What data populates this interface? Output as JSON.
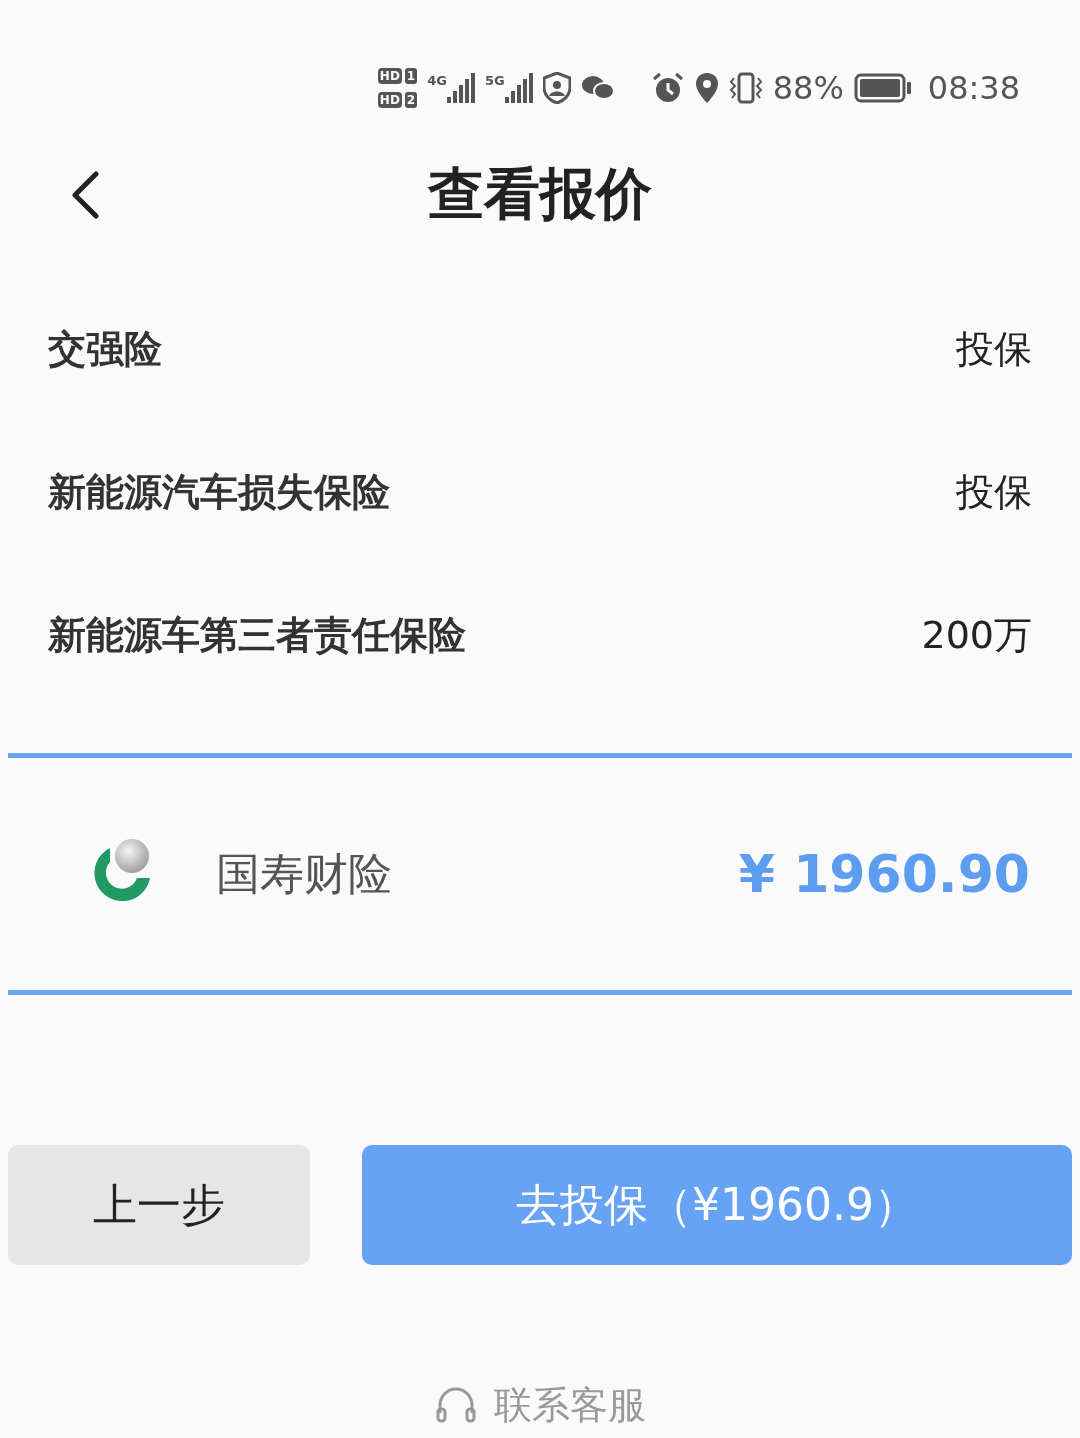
{
  "status_bar": {
    "sims": [
      {
        "label": "HD",
        "slot": "1"
      },
      {
        "label": "HD",
        "slot": "2"
      }
    ],
    "networks": [
      "4G",
      "5G"
    ],
    "battery_text": "88%",
    "time": "08:38"
  },
  "header": {
    "title": "查看报价"
  },
  "coverages": [
    {
      "name": "交强险",
      "value": "投保"
    },
    {
      "name": "新能源汽车损失保险",
      "value": "投保"
    },
    {
      "name": "新能源车第三者责任保险",
      "value": "200万"
    }
  ],
  "quote": {
    "company": "国寿财险",
    "price": "¥ 1960.90"
  },
  "buttons": [
    {
      "kind": "secondary",
      "label": "上一步"
    },
    {
      "kind": "primary",
      "label": "去投保（¥1960.9）"
    }
  ],
  "footer": {
    "label": "联系客服"
  }
}
